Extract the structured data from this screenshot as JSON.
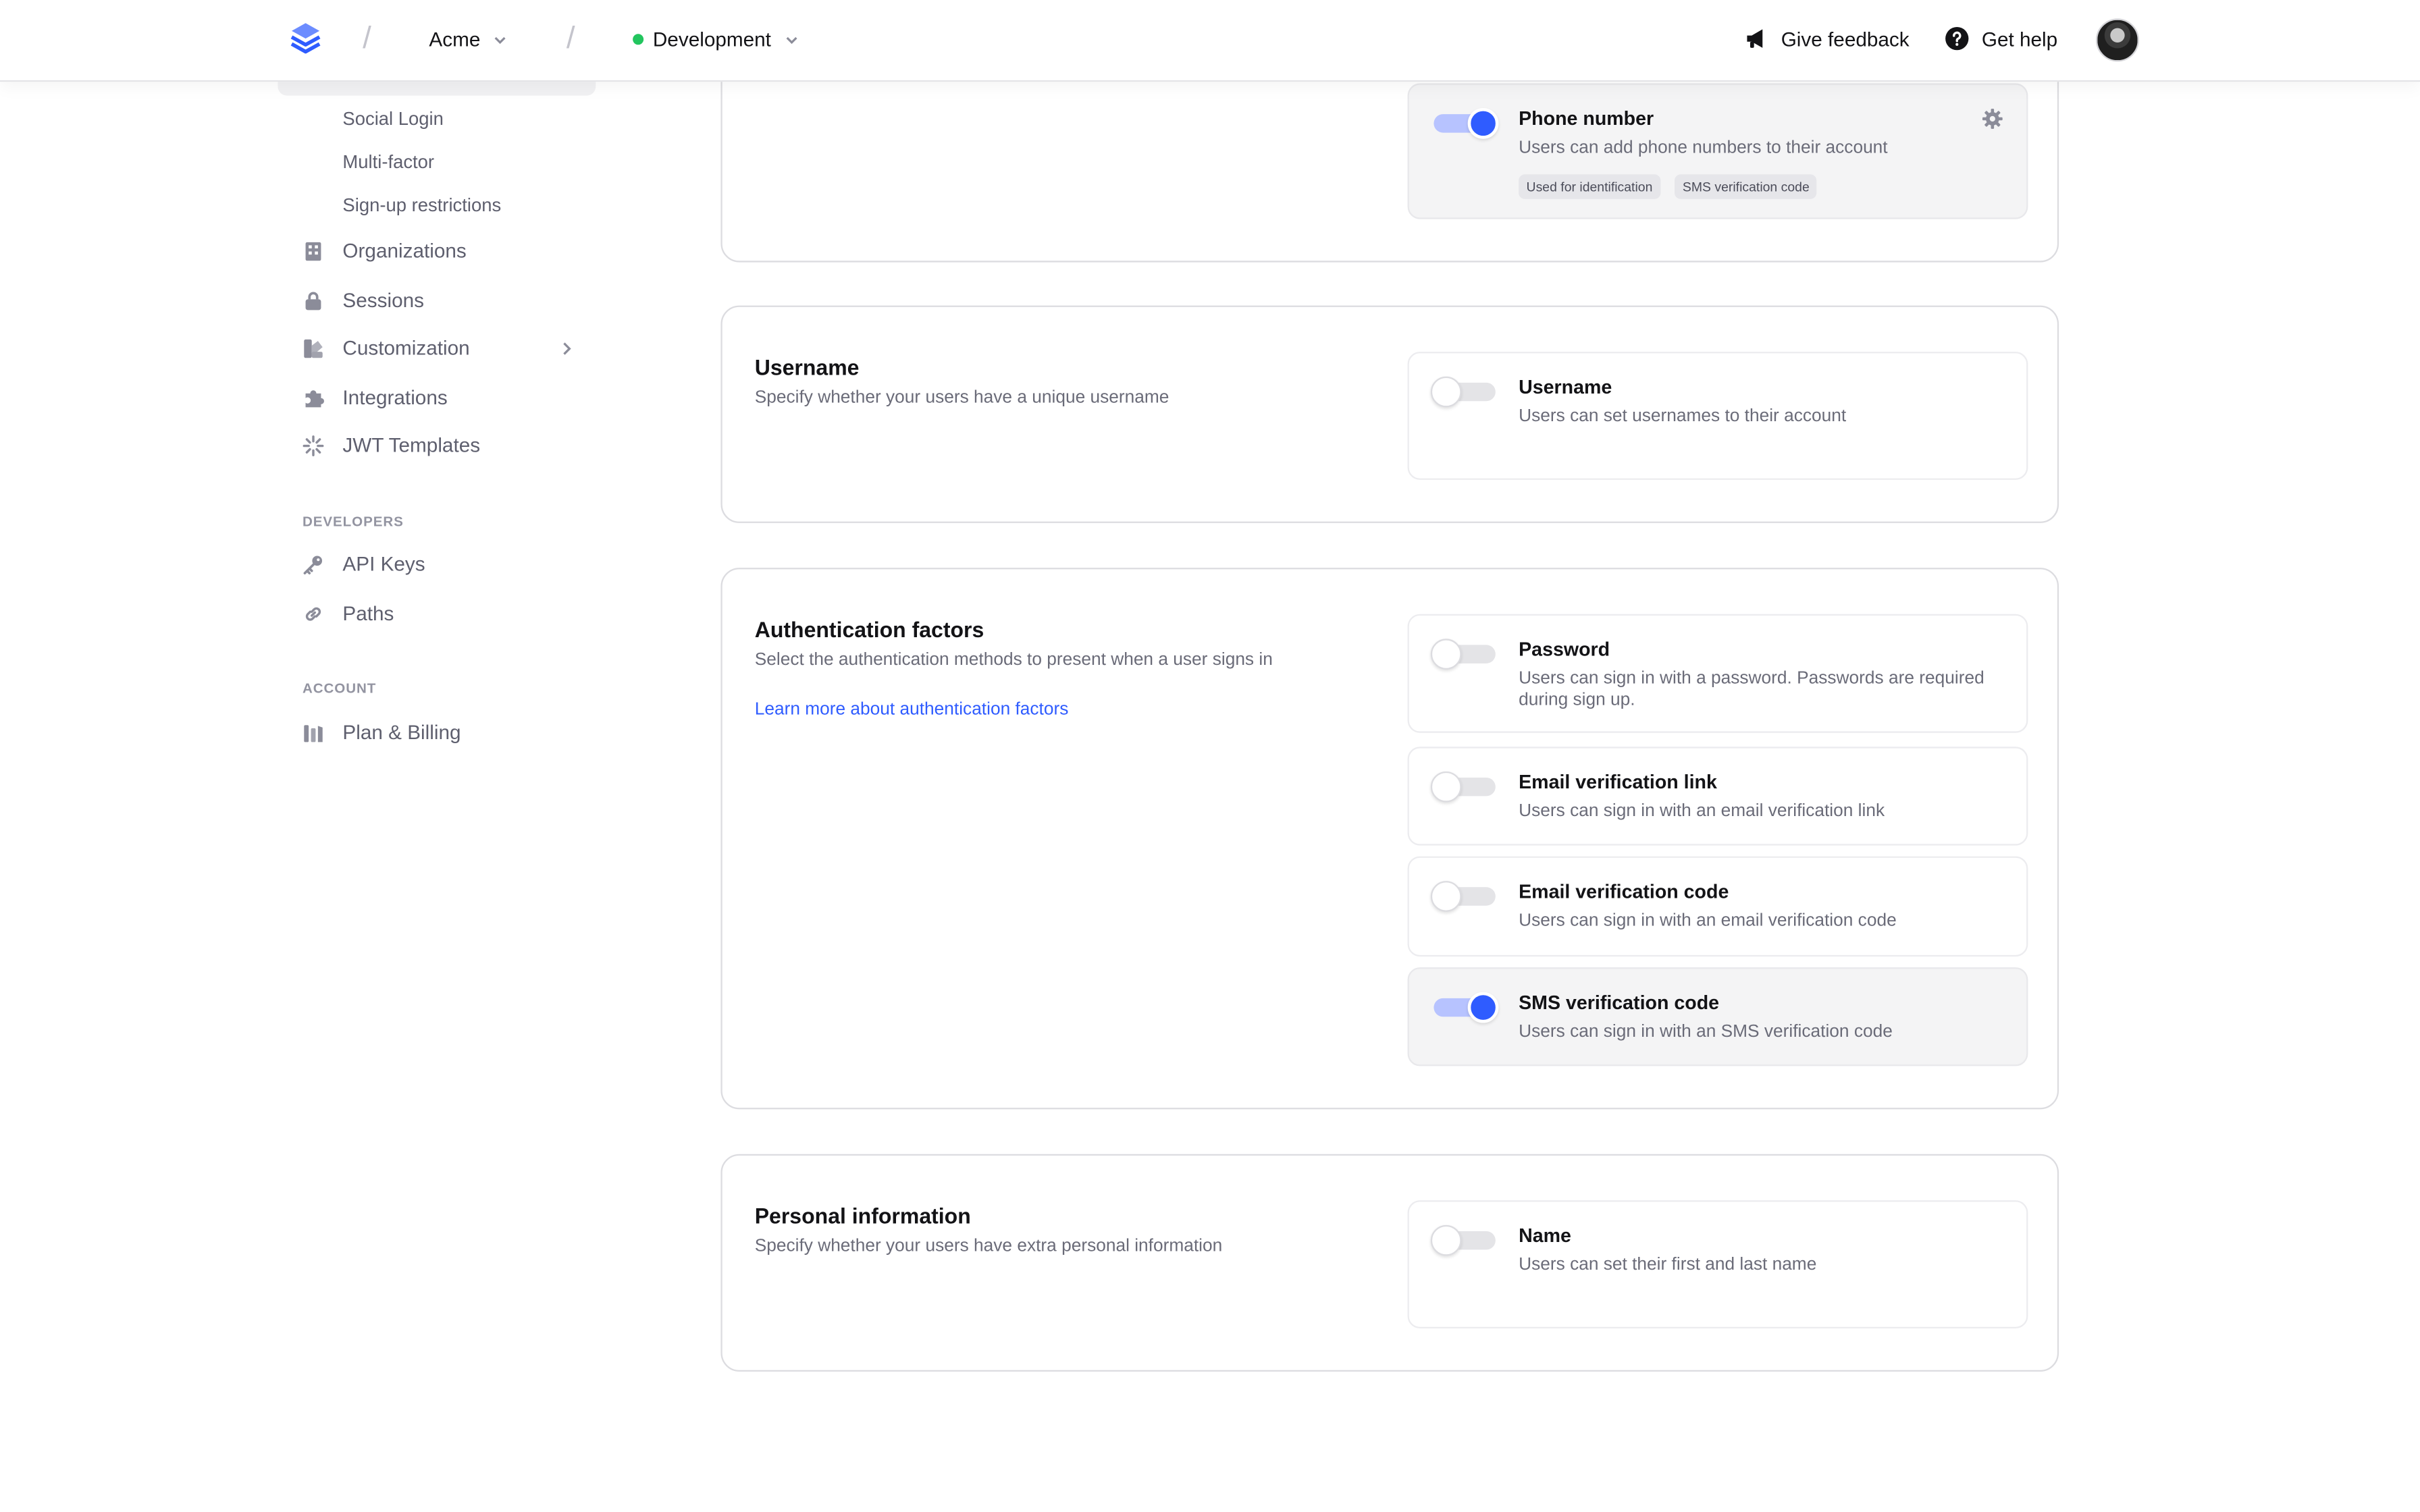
{
  "topbar": {
    "org_name": "Acme",
    "environment": "Development",
    "feedback_label": "Give feedback",
    "help_label": "Get help",
    "colors": {
      "brand": "#2f5cff",
      "env_dot": "#22c55e"
    }
  },
  "sidebar": {
    "sub_items": [
      "Social Login",
      "Multi-factor",
      "Sign-up restrictions"
    ],
    "items": [
      {
        "label": "Organizations",
        "icon": "building-icon"
      },
      {
        "label": "Sessions",
        "icon": "lock-icon"
      },
      {
        "label": "Customization",
        "icon": "palette-icon"
      },
      {
        "label": "Integrations",
        "icon": "puzzle-icon"
      },
      {
        "label": "JWT Templates",
        "icon": "sparkle-icon"
      }
    ],
    "developers_label": "DEVELOPERS",
    "developers_items": [
      {
        "label": "API Keys",
        "icon": "key-icon"
      },
      {
        "label": "Paths",
        "icon": "link-icon"
      }
    ],
    "account_label": "ACCOUNT",
    "account_items": [
      {
        "label": "Plan & Billing",
        "icon": "billing-icon"
      }
    ]
  },
  "phone": {
    "title": "Phone number",
    "desc": "Users can add phone numbers to their account",
    "tags": [
      "Used for identification",
      "SMS verification code"
    ],
    "enabled": true
  },
  "username_card": {
    "title": "Username",
    "desc": "Specify whether your users have a unique username",
    "option": {
      "title": "Username",
      "desc": "Users can set usernames to their account",
      "enabled": false
    }
  },
  "auth_card": {
    "title": "Authentication factors",
    "desc": "Select the authentication methods to present when a user signs in",
    "link": "Learn more about authentication factors",
    "options": [
      {
        "title": "Password",
        "desc": "Users can sign in with a password. Passwords are required during sign up.",
        "enabled": false
      },
      {
        "title": "Email verification link",
        "desc": "Users can sign in with an email verification link",
        "enabled": false
      },
      {
        "title": "Email verification code",
        "desc": "Users can sign in with an email verification code",
        "enabled": false
      },
      {
        "title": "SMS verification code",
        "desc": "Users can sign in with an SMS verification code",
        "enabled": true
      }
    ]
  },
  "personal_card": {
    "title": "Personal information",
    "desc": "Specify whether your users have extra personal information",
    "option": {
      "title": "Name",
      "desc": "Users can set their first and last name",
      "enabled": false
    }
  }
}
